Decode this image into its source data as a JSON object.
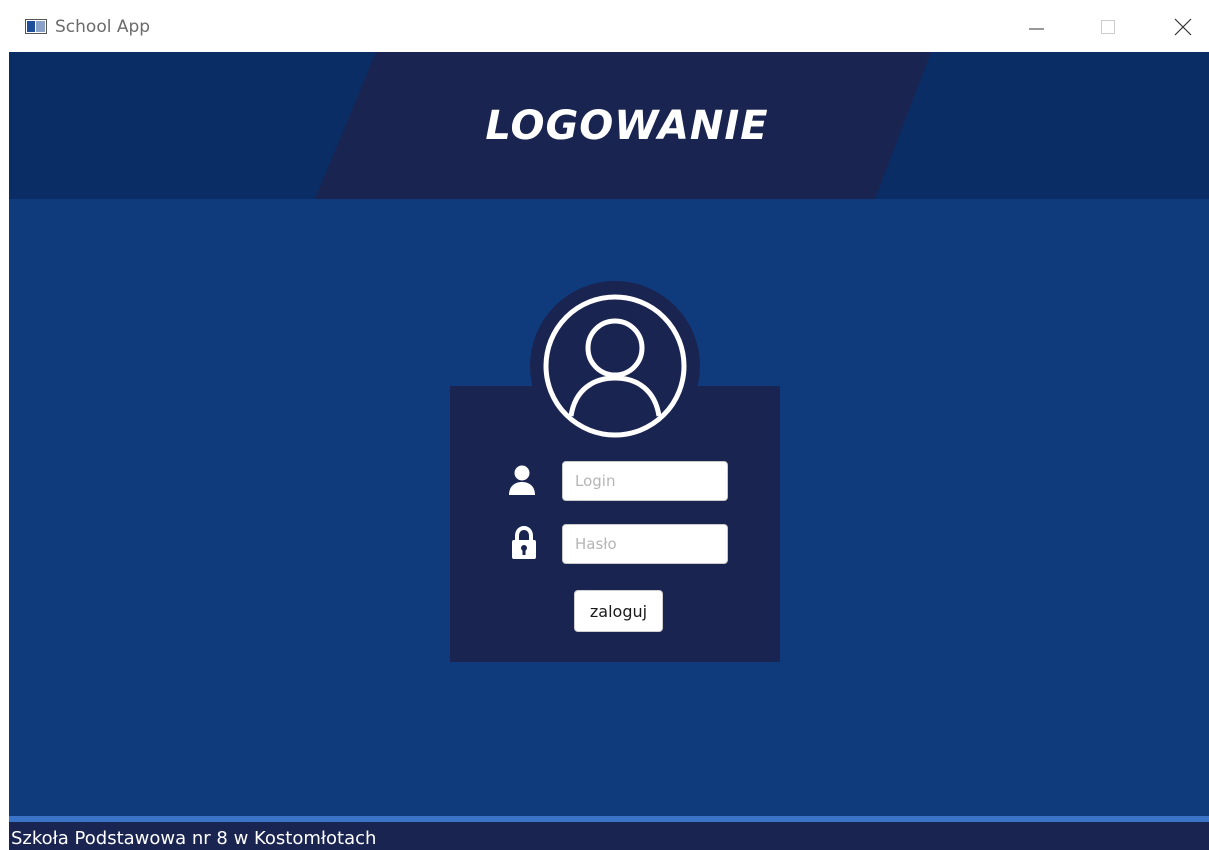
{
  "window": {
    "title": "School App",
    "app_icon": "window-app-icon",
    "controls": {
      "minimize_icon": "minimize-icon",
      "maximize_icon": "maximize-icon",
      "close_icon": "close-icon"
    }
  },
  "header": {
    "title": "LOGOWANIE"
  },
  "login_form": {
    "avatar_icon": "user-circle-icon",
    "login_field": {
      "icon": "user-icon",
      "placeholder": "Login",
      "value": ""
    },
    "password_field": {
      "icon": "lock-icon",
      "placeholder": "Hasło",
      "value": ""
    },
    "submit_label": "zaloguj"
  },
  "footer": {
    "text": "Szkoła Podstawowa nr 8 w Kostomłotach"
  },
  "colors": {
    "window_bg": "#0f3b7d",
    "header_band": "#0a2d66",
    "header_center": "#1a2450",
    "card_bg": "#1a2450",
    "footer_bg": "#1a2450",
    "footer_line": "#3a73c7",
    "text_primary": "#ffffff"
  }
}
